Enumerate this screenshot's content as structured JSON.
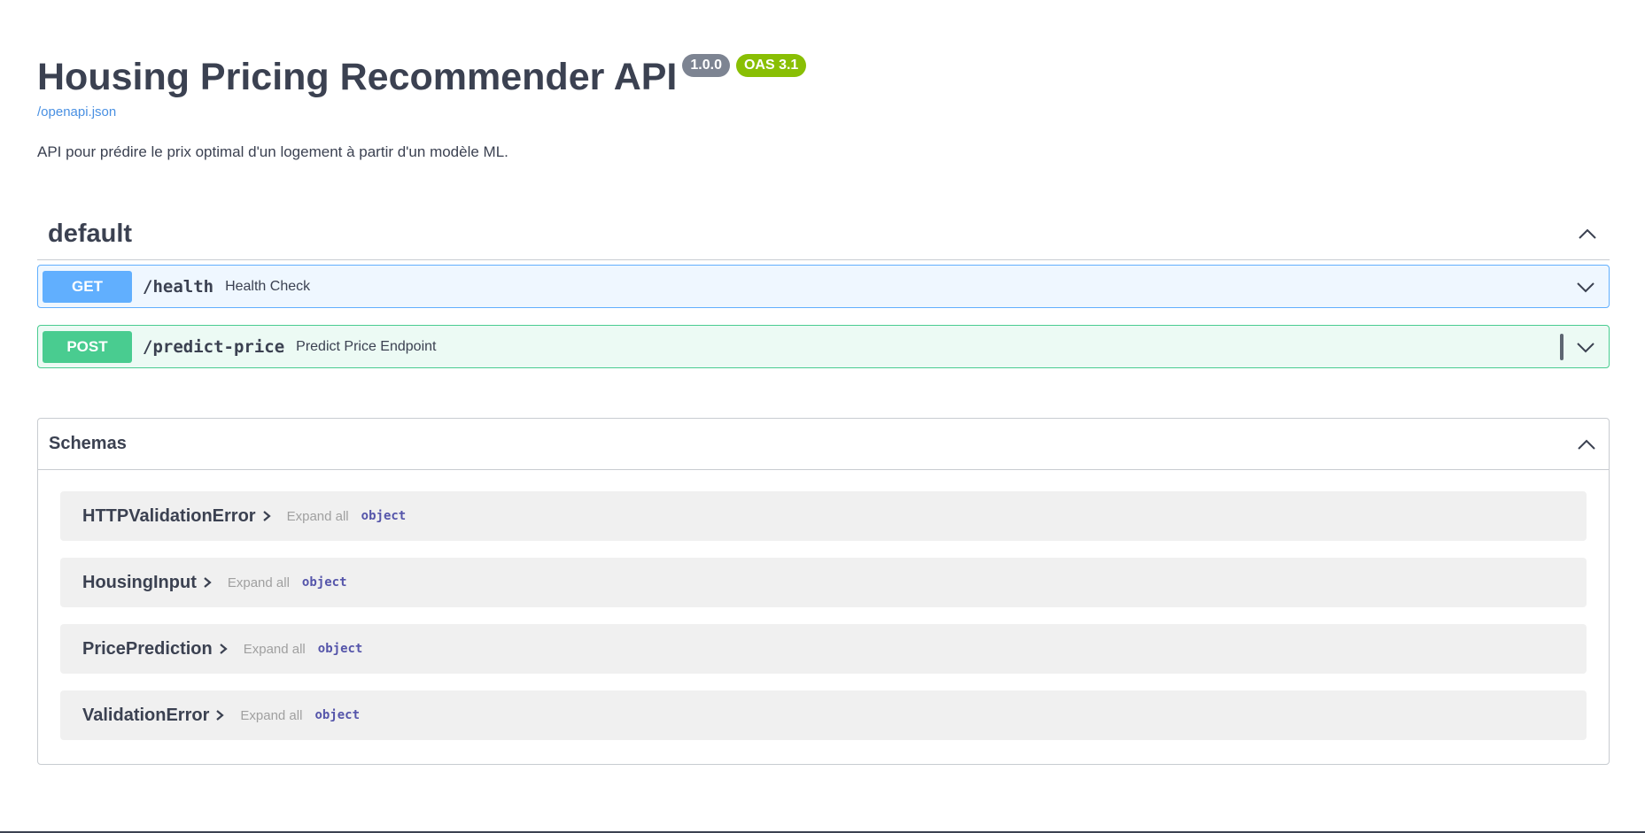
{
  "info": {
    "title": "Housing Pricing Recommender API",
    "version": "1.0.0",
    "oas": "OAS 3.1",
    "spec_link": "/openapi.json",
    "description": "API pour prédire le prix optimal d'un logement à partir d'un modèle ML."
  },
  "tag": {
    "name": "default",
    "collapse_icon": "chevron-up-icon"
  },
  "operations": [
    {
      "method": "GET",
      "path": "/health",
      "summary": "Health Check",
      "color": "#61affe"
    },
    {
      "method": "POST",
      "path": "/predict-price",
      "summary": "Predict Price Endpoint",
      "color": "#49cc90"
    }
  ],
  "schemas": {
    "title": "Schemas",
    "models": [
      {
        "name": "HTTPValidationError",
        "expand": "Expand all",
        "type": "object"
      },
      {
        "name": "HousingInput",
        "expand": "Expand all",
        "type": "object"
      },
      {
        "name": "PricePrediction",
        "expand": "Expand all",
        "type": "object"
      },
      {
        "name": "ValidationError",
        "expand": "Expand all",
        "type": "object"
      }
    ]
  }
}
